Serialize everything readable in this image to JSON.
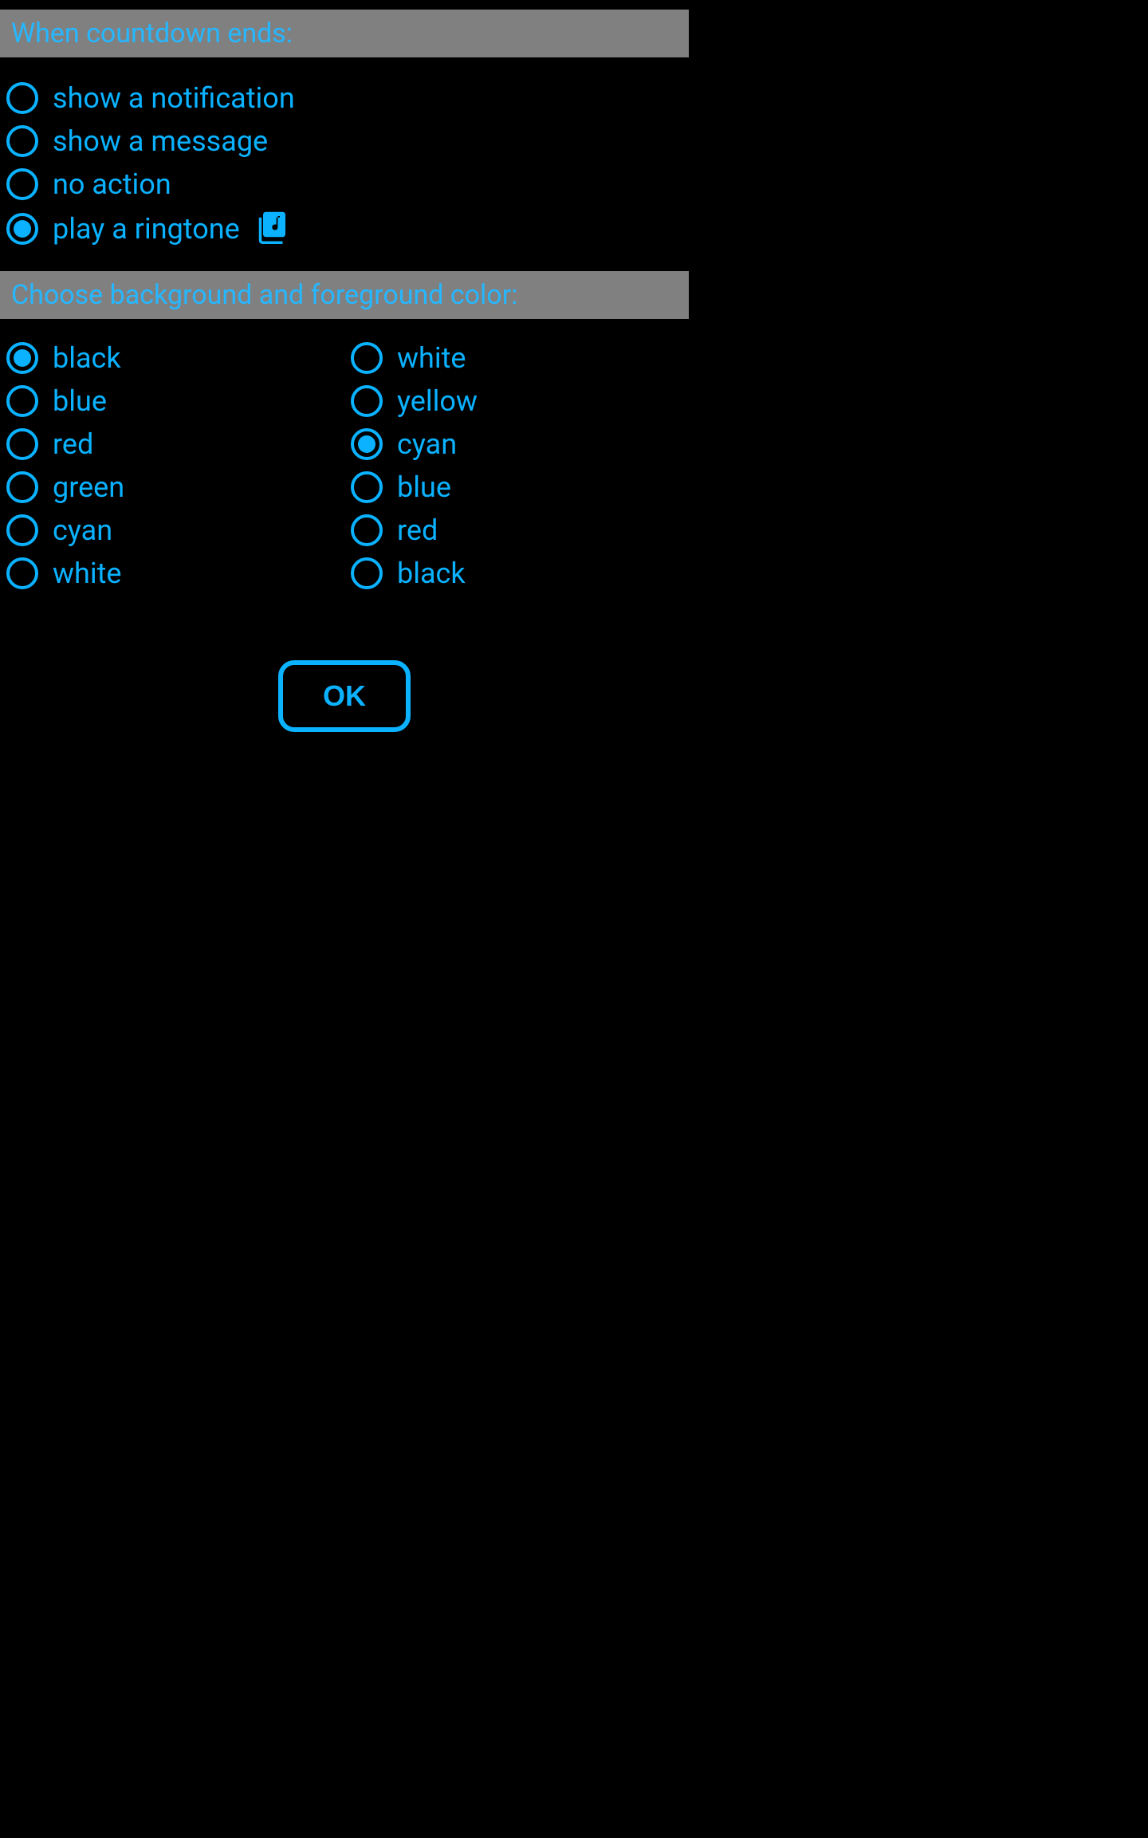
{
  "section1": {
    "title": "When countdown ends:",
    "options": [
      {
        "label": "show a notification",
        "selected": false
      },
      {
        "label": "show a message",
        "selected": false
      },
      {
        "label": "no action",
        "selected": false
      },
      {
        "label": "play a ringtone",
        "selected": true
      }
    ]
  },
  "section2": {
    "title": "Choose background and foreground color:",
    "backgroundColors": [
      {
        "label": "black",
        "selected": true
      },
      {
        "label": "blue",
        "selected": false
      },
      {
        "label": "red",
        "selected": false
      },
      {
        "label": "green",
        "selected": false
      },
      {
        "label": "cyan",
        "selected": false
      },
      {
        "label": "white",
        "selected": false
      }
    ],
    "foregroundColors": [
      {
        "label": "white",
        "selected": false
      },
      {
        "label": "yellow",
        "selected": false
      },
      {
        "label": "cyan",
        "selected": true
      },
      {
        "label": "blue",
        "selected": false
      },
      {
        "label": "red",
        "selected": false
      },
      {
        "label": "black",
        "selected": false
      }
    ]
  },
  "okButtonLabel": "OK"
}
